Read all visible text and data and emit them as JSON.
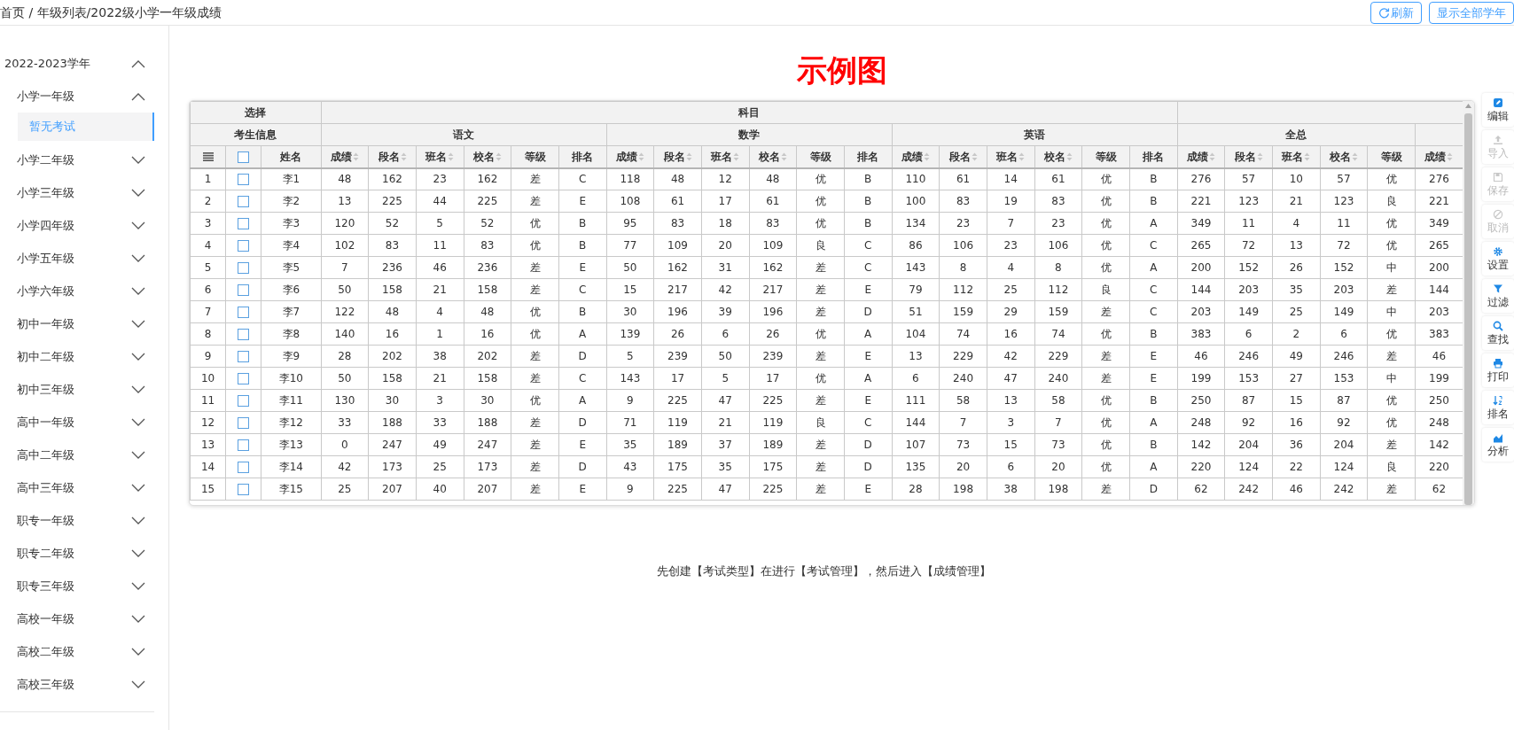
{
  "breadcrumb": "首页 / 年级列表/2022级小学一年级成绩",
  "header_buttons": [
    {
      "label": "刷新",
      "has_icon": true
    },
    {
      "label": "显示全部学年",
      "has_icon": false
    }
  ],
  "sidebar": {
    "items": [
      {
        "label": "2022-2023学年",
        "expanded": true,
        "children": [
          {
            "label": "小学一年级",
            "expanded": true,
            "children": [
              {
                "label": "暂无考试",
                "selected": true
              }
            ]
          },
          {
            "label": "小学二年级",
            "expanded": false
          },
          {
            "label": "小学三年级",
            "expanded": false
          },
          {
            "label": "小学四年级",
            "expanded": false
          },
          {
            "label": "小学五年级",
            "expanded": false
          },
          {
            "label": "小学六年级",
            "expanded": false
          },
          {
            "label": "初中一年级",
            "expanded": false
          },
          {
            "label": "初中二年级",
            "expanded": false
          },
          {
            "label": "初中三年级",
            "expanded": false
          },
          {
            "label": "高中一年级",
            "expanded": false
          },
          {
            "label": "高中二年级",
            "expanded": false
          },
          {
            "label": "高中三年级",
            "expanded": false
          },
          {
            "label": "职专一年级",
            "expanded": false
          },
          {
            "label": "职专二年级",
            "expanded": false
          },
          {
            "label": "职专三年级",
            "expanded": false
          },
          {
            "label": "高校一年级",
            "expanded": false
          },
          {
            "label": "高校二年级",
            "expanded": false
          },
          {
            "label": "高校三年级",
            "expanded": false
          }
        ]
      }
    ]
  },
  "title": "示例图",
  "sheet": {
    "select_label": "选择",
    "subject_label": "科目",
    "info_group": {
      "label": "考生信息",
      "all_checked": false,
      "name_label": "姓名"
    },
    "groups": [
      {
        "label": "语文",
        "columns": [
          {
            "label": "成绩",
            "sortable": true
          },
          {
            "label": "段名",
            "sortable": true
          },
          {
            "label": "班名",
            "sortable": true
          },
          {
            "label": "校名",
            "sortable": true
          },
          {
            "label": "等级",
            "sortable": false
          },
          {
            "label": "排名",
            "sortable": false
          }
        ]
      },
      {
        "label": "数学",
        "columns": [
          {
            "label": "成绩",
            "sortable": true
          },
          {
            "label": "段名",
            "sortable": true
          },
          {
            "label": "班名",
            "sortable": true
          },
          {
            "label": "校名",
            "sortable": true
          },
          {
            "label": "等级",
            "sortable": false
          },
          {
            "label": "排名",
            "sortable": false
          }
        ]
      },
      {
        "label": "英语",
        "columns": [
          {
            "label": "成绩",
            "sortable": true
          },
          {
            "label": "段名",
            "sortable": true
          },
          {
            "label": "班名",
            "sortable": true
          },
          {
            "label": "校名",
            "sortable": true
          },
          {
            "label": "等级",
            "sortable": false
          },
          {
            "label": "排名",
            "sortable": false
          }
        ]
      }
    ],
    "total": {
      "label": "全总",
      "columns": [
        {
          "label": "成绩",
          "sortable": true
        },
        {
          "label": "段名",
          "sortable": true
        },
        {
          "label": "班名",
          "sortable": true
        },
        {
          "label": "校名",
          "sortable": true
        },
        {
          "label": "等级",
          "sortable": false
        }
      ]
    },
    "extra_columns": [
      {
        "label": "成绩",
        "sortable": true
      }
    ],
    "rows": [
      {
        "index": "1",
        "checked": false,
        "name": "李1",
        "cells": [
          "48",
          "162",
          "23",
          "162",
          "差",
          "C",
          "118",
          "48",
          "12",
          "48",
          "优",
          "B",
          "110",
          "61",
          "14",
          "61",
          "优",
          "B",
          "276",
          "57",
          "10",
          "57",
          "优",
          "276"
        ]
      },
      {
        "index": "2",
        "checked": false,
        "name": "李2",
        "cells": [
          "13",
          "225",
          "44",
          "225",
          "差",
          "E",
          "108",
          "61",
          "17",
          "61",
          "优",
          "B",
          "100",
          "83",
          "19",
          "83",
          "优",
          "B",
          "221",
          "123",
          "21",
          "123",
          "良",
          "221"
        ]
      },
      {
        "index": "3",
        "checked": false,
        "name": "李3",
        "cells": [
          "120",
          "52",
          "5",
          "52",
          "优",
          "B",
          "95",
          "83",
          "18",
          "83",
          "优",
          "B",
          "134",
          "23",
          "7",
          "23",
          "优",
          "A",
          "349",
          "11",
          "4",
          "11",
          "优",
          "349"
        ]
      },
      {
        "index": "4",
        "checked": false,
        "name": "李4",
        "cells": [
          "102",
          "83",
          "11",
          "83",
          "优",
          "B",
          "77",
          "109",
          "20",
          "109",
          "良",
          "C",
          "86",
          "106",
          "23",
          "106",
          "优",
          "C",
          "265",
          "72",
          "13",
          "72",
          "优",
          "265"
        ]
      },
      {
        "index": "5",
        "checked": false,
        "name": "李5",
        "cells": [
          "7",
          "236",
          "46",
          "236",
          "差",
          "E",
          "50",
          "162",
          "31",
          "162",
          "差",
          "C",
          "143",
          "8",
          "4",
          "8",
          "优",
          "A",
          "200",
          "152",
          "26",
          "152",
          "中",
          "200"
        ]
      },
      {
        "index": "6",
        "checked": false,
        "name": "李6",
        "cells": [
          "50",
          "158",
          "21",
          "158",
          "差",
          "C",
          "15",
          "217",
          "42",
          "217",
          "差",
          "E",
          "79",
          "112",
          "25",
          "112",
          "良",
          "C",
          "144",
          "203",
          "35",
          "203",
          "差",
          "144"
        ]
      },
      {
        "index": "7",
        "checked": false,
        "name": "李7",
        "cells": [
          "122",
          "48",
          "4",
          "48",
          "优",
          "B",
          "30",
          "196",
          "39",
          "196",
          "差",
          "D",
          "51",
          "159",
          "29",
          "159",
          "差",
          "C",
          "203",
          "149",
          "25",
          "149",
          "中",
          "203"
        ]
      },
      {
        "index": "8",
        "checked": false,
        "name": "李8",
        "cells": [
          "140",
          "16",
          "1",
          "16",
          "优",
          "A",
          "139",
          "26",
          "6",
          "26",
          "优",
          "A",
          "104",
          "74",
          "16",
          "74",
          "优",
          "B",
          "383",
          "6",
          "2",
          "6",
          "优",
          "383"
        ]
      },
      {
        "index": "9",
        "checked": false,
        "name": "李9",
        "cells": [
          "28",
          "202",
          "38",
          "202",
          "差",
          "D",
          "5",
          "239",
          "50",
          "239",
          "差",
          "E",
          "13",
          "229",
          "42",
          "229",
          "差",
          "E",
          "46",
          "246",
          "49",
          "246",
          "差",
          "46"
        ]
      },
      {
        "index": "10",
        "checked": false,
        "name": "李10",
        "cells": [
          "50",
          "158",
          "21",
          "158",
          "差",
          "C",
          "143",
          "17",
          "5",
          "17",
          "优",
          "A",
          "6",
          "240",
          "47",
          "240",
          "差",
          "E",
          "199",
          "153",
          "27",
          "153",
          "中",
          "199"
        ]
      },
      {
        "index": "11",
        "checked": false,
        "name": "李11",
        "cells": [
          "130",
          "30",
          "3",
          "30",
          "优",
          "A",
          "9",
          "225",
          "47",
          "225",
          "差",
          "E",
          "111",
          "58",
          "13",
          "58",
          "优",
          "B",
          "250",
          "87",
          "15",
          "87",
          "优",
          "250"
        ]
      },
      {
        "index": "12",
        "checked": false,
        "name": "李12",
        "cells": [
          "33",
          "188",
          "33",
          "188",
          "差",
          "D",
          "71",
          "119",
          "21",
          "119",
          "良",
          "C",
          "144",
          "7",
          "3",
          "7",
          "优",
          "A",
          "248",
          "92",
          "16",
          "92",
          "优",
          "248"
        ]
      },
      {
        "index": "13",
        "checked": false,
        "name": "李13",
        "cells": [
          "0",
          "247",
          "49",
          "247",
          "差",
          "E",
          "35",
          "189",
          "37",
          "189",
          "差",
          "D",
          "107",
          "73",
          "15",
          "73",
          "优",
          "B",
          "142",
          "204",
          "36",
          "204",
          "差",
          "142"
        ]
      },
      {
        "index": "14",
        "checked": false,
        "name": "李14",
        "cells": [
          "42",
          "173",
          "25",
          "173",
          "差",
          "D",
          "43",
          "175",
          "35",
          "175",
          "差",
          "D",
          "135",
          "20",
          "6",
          "20",
          "优",
          "A",
          "220",
          "124",
          "22",
          "124",
          "良",
          "220"
        ]
      },
      {
        "index": "15",
        "checked": false,
        "name": "李15",
        "cells": [
          "25",
          "207",
          "40",
          "207",
          "差",
          "E",
          "9",
          "225",
          "47",
          "225",
          "差",
          "E",
          "28",
          "198",
          "38",
          "198",
          "差",
          "D",
          "62",
          "242",
          "46",
          "242",
          "差",
          "62"
        ]
      }
    ]
  },
  "toolbar": [
    {
      "label": "编辑",
      "disabled": false
    },
    {
      "label": "导入",
      "disabled": true
    },
    {
      "label": "保存",
      "disabled": true
    },
    {
      "label": "取消",
      "disabled": true
    },
    {
      "label": "设置",
      "disabled": false
    },
    {
      "label": "过滤",
      "disabled": false
    },
    {
      "label": "查找",
      "disabled": false
    },
    {
      "label": "打印",
      "disabled": false
    },
    {
      "label": "排名",
      "disabled": false
    },
    {
      "label": "分析",
      "disabled": false
    }
  ],
  "footer_note": "先创建【考试类型】在进行【考试管理】，然后进入【成绩管理】"
}
